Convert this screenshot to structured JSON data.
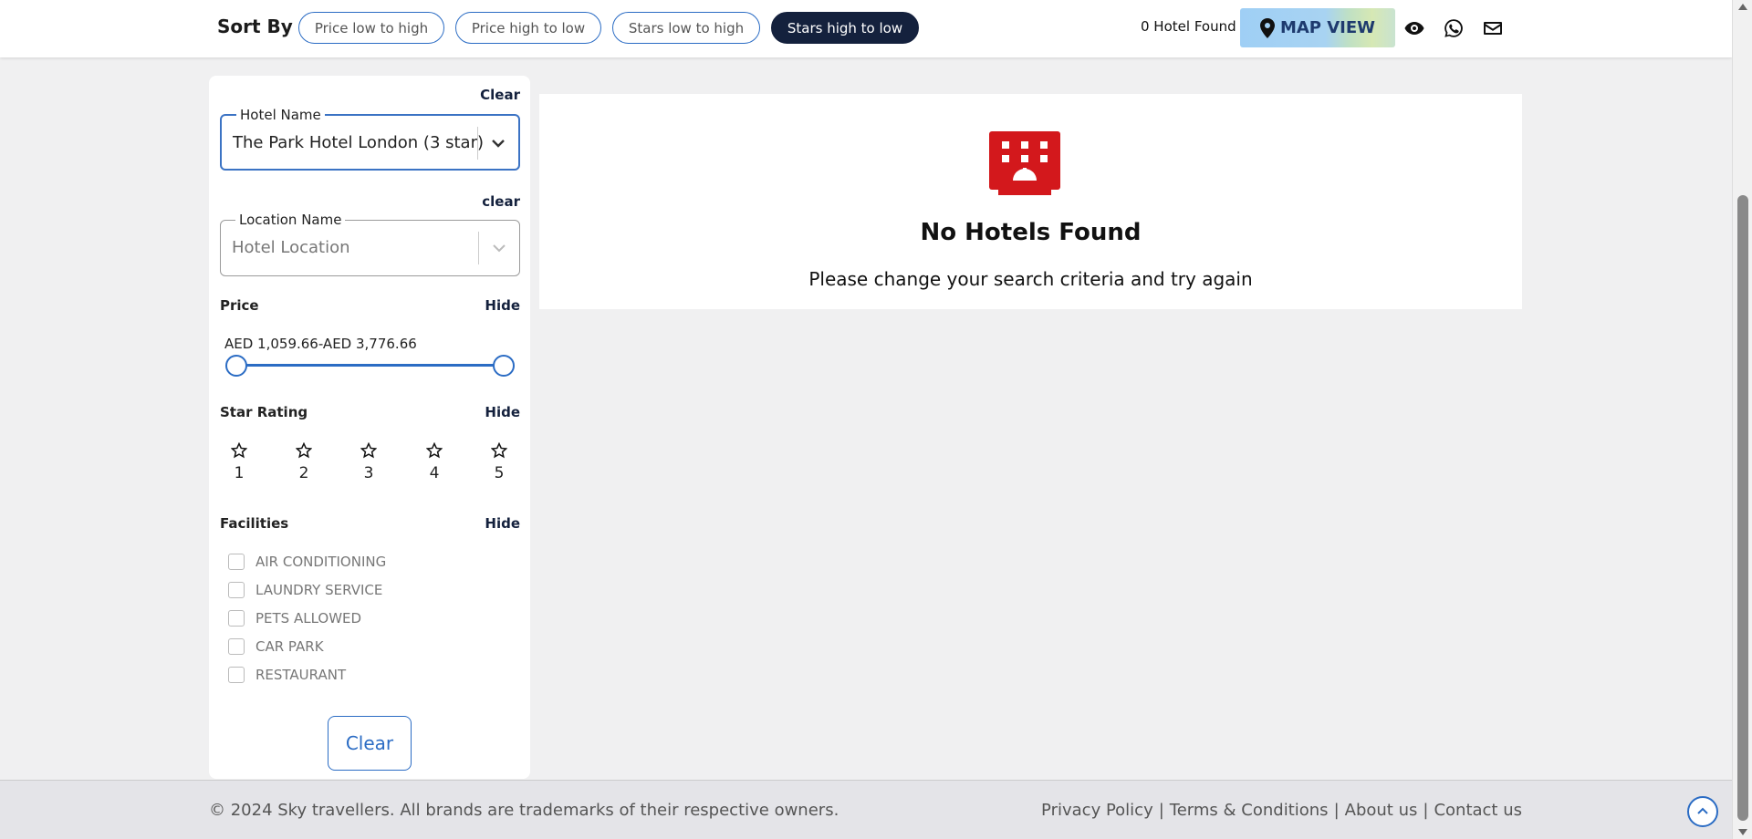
{
  "sort": {
    "label": "Sort By :",
    "options": [
      "Price low to high",
      "Price high to low",
      "Stars low to high",
      "Stars high to low"
    ],
    "active_index": 3
  },
  "header": {
    "found_text": "0 Hotel Found",
    "map_view_label": "MAP VIEW"
  },
  "sidebar": {
    "clear_top": "Clear",
    "hotel_name": {
      "legend": "Hotel Name",
      "value": "The Park Hotel London (3 star)"
    },
    "clear_location": "clear",
    "location_name": {
      "legend": "Location Name",
      "placeholder": "Hotel Location"
    },
    "price": {
      "title": "Price",
      "hide": "Hide",
      "range_text": "AED 1,059.66-AED 3,776.66"
    },
    "star_rating": {
      "title": "Star Rating",
      "hide": "Hide",
      "stars": [
        "1",
        "2",
        "3",
        "4",
        "5"
      ]
    },
    "facilities": {
      "title": "Facilities",
      "hide": "Hide",
      "items": [
        "AIR CONDITIONING",
        "LAUNDRY SERVICE",
        "PETS ALLOWED",
        "CAR PARK",
        "RESTAURANT"
      ]
    },
    "clear_button": "Clear"
  },
  "result": {
    "title": "No Hotels Found",
    "subtitle": "Please change your search criteria and try again",
    "icon_color": "#d3181c"
  },
  "footer": {
    "copyright": "© 2024 Sky travellers. All brands are trademarks of their respective owners.",
    "links": [
      "Privacy Policy",
      "Terms & Conditions",
      "About us",
      "Contact us"
    ],
    "separator": "|"
  },
  "colors": {
    "accent": "#2b6cc4",
    "active_sort": "#14213d",
    "hotel_icon": "#d3181c"
  }
}
